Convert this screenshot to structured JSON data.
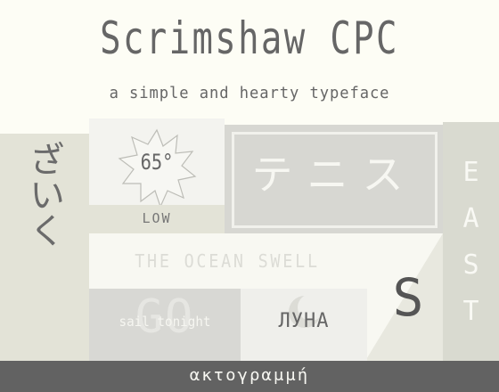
{
  "header": {
    "title": "Scrimshaw CPC",
    "subtitle": "a simple and hearty typeface"
  },
  "left_panel": {
    "kana": "ざいく"
  },
  "weather": {
    "temperature": "65°",
    "low_label": "LOW",
    "icon": "sun-icon"
  },
  "tennis": {
    "text": "テニス"
  },
  "direction": {
    "text": "E\nA\nS\nT"
  },
  "ocean": {
    "text": "THE OCEAN SWELL"
  },
  "letter": {
    "text": "S"
  },
  "sail": {
    "watermark": "GO",
    "text": "sail tonight"
  },
  "moon": {
    "text": "ЛУНА",
    "icon": "crescent-moon-icon"
  },
  "footer": {
    "text": "ακτογραμμή"
  },
  "colors": {
    "background": "#fdfdf5",
    "panel_beige": "#e3e3d7",
    "panel_gray": "#d7d7d2",
    "footer_dark": "#626262",
    "text_dark": "#666666"
  }
}
